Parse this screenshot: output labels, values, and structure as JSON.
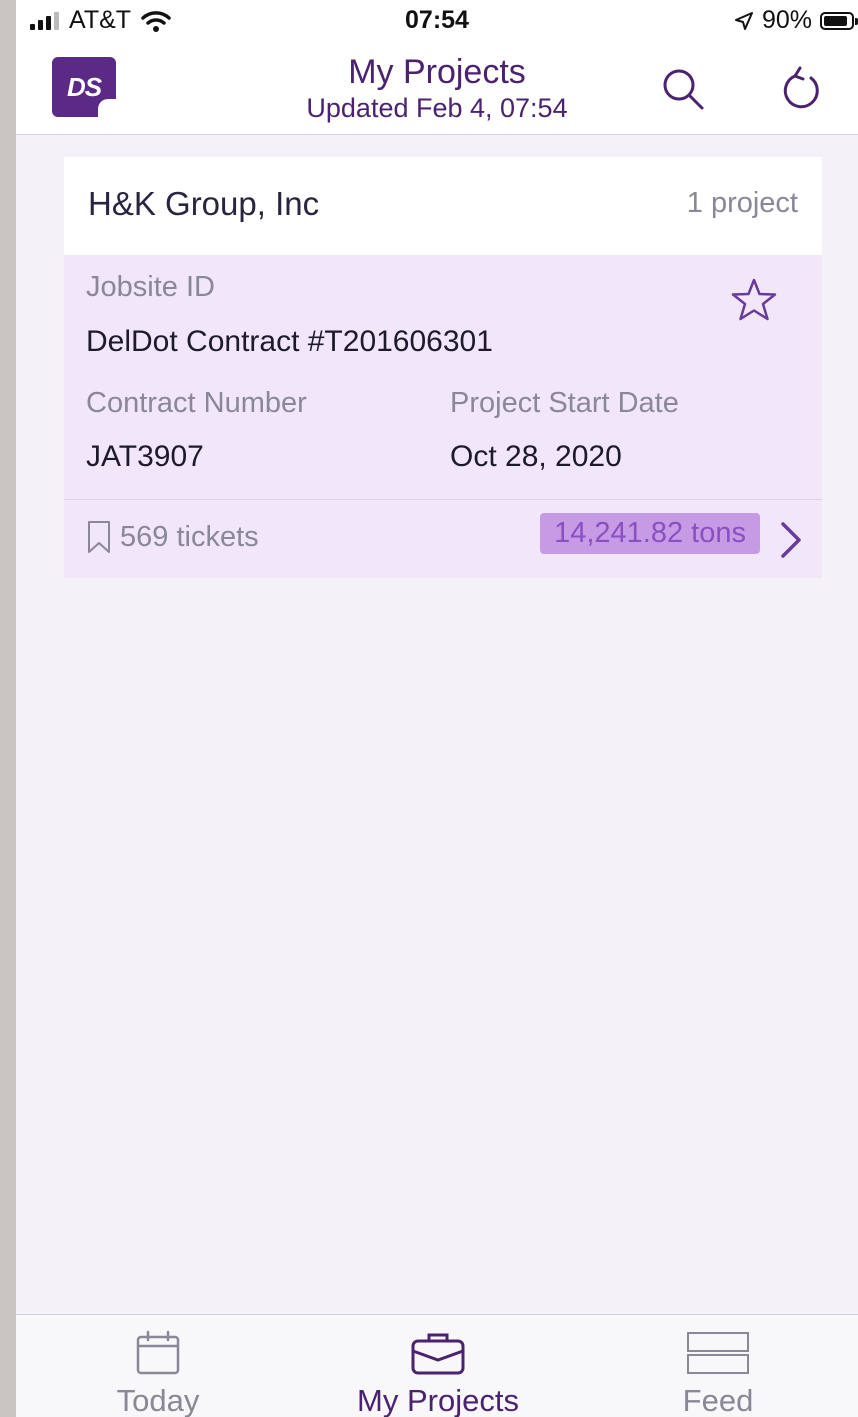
{
  "status_bar": {
    "carrier": "AT&T",
    "time": "07:54",
    "battery": "90%"
  },
  "header": {
    "logo_text": "DS",
    "title": "My Projects",
    "subtitle": "Updated Feb 4, 07:54"
  },
  "company": {
    "name": "H&K Group, Inc",
    "count": "1 project"
  },
  "project": {
    "jobsite_label": "Jobsite ID",
    "jobsite_value": "DelDot Contract #T201606301",
    "contract_label": "Contract Number",
    "contract_value": "JAT3907",
    "start_label": "Project Start Date",
    "start_value": "Oct 28, 2020",
    "tickets": "569 tickets",
    "tons": "14,241.82 tons"
  },
  "tabs": [
    {
      "label": "Today",
      "icon": "calendar-icon"
    },
    {
      "label": "My Projects",
      "icon": "briefcase-icon"
    },
    {
      "label": "Feed",
      "icon": "feed-icon"
    }
  ],
  "colors": {
    "accent": "#4a2270",
    "project_bg": "#f1e7f8",
    "tons_bg": "#c79ae5",
    "tons_text": "#8a4fc0",
    "muted": "#8a8796"
  }
}
